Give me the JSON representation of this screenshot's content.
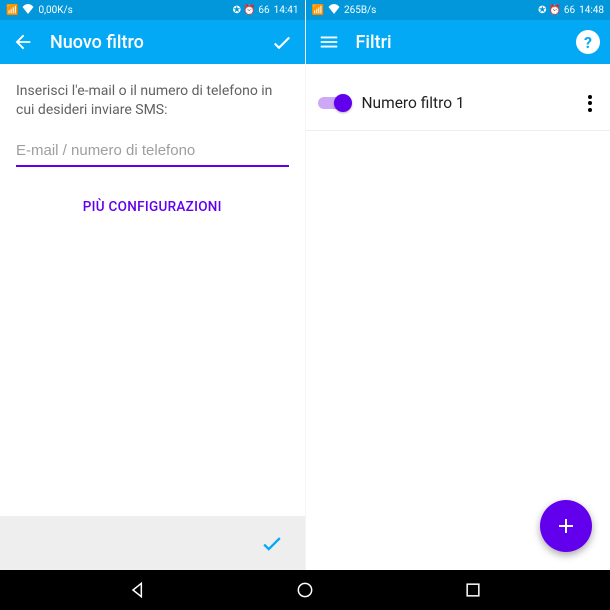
{
  "left": {
    "status": {
      "signal": "▮",
      "wifi": "✦",
      "speed": "0,00K/s",
      "right_icons": "✪ ⏰ 66",
      "time": "14:41"
    },
    "appbar": {
      "title": "Nuovo filtro"
    },
    "instruction": "Inserisci l'e-mail o il numero di telefono in cui desideri inviare SMS:",
    "input": {
      "value": "",
      "placeholder": "E-mail / numero di telefono"
    },
    "more_config": "PIÙ CONFIGURAZIONI"
  },
  "right": {
    "status": {
      "signal": "▮",
      "wifi": "✦",
      "speed": "265B/s",
      "right_icons": "✪ ⏰ 66",
      "time": "14:48"
    },
    "appbar": {
      "title": "Filtri",
      "help": "?"
    },
    "filters": [
      {
        "label": "Numero filtro 1",
        "enabled": true
      }
    ]
  },
  "colors": {
    "primary_blue": "#03a9f4",
    "status_blue": "#0296db",
    "accent_purple": "#6200ee"
  }
}
